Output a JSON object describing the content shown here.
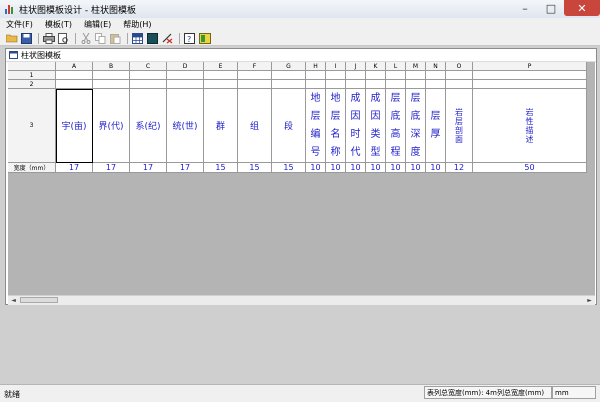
{
  "window": {
    "title": "柱状图模板设计 - 柱状图模板"
  },
  "menu": [
    "文件(F)",
    "模板(T)",
    "编辑(E)",
    "帮助(H)"
  ],
  "toolbar": [
    "open-icon",
    "save-icon",
    "print-icon",
    "print-preview-icon",
    "cut-icon",
    "copy-icon",
    "paste-icon",
    "grid-icon",
    "column-icon",
    "delete-column-icon",
    "help-icon",
    "about-icon"
  ],
  "child": {
    "title": "柱状图模板"
  },
  "grid": {
    "row_headers": [
      "1",
      "2",
      "3",
      "宽度（mm）"
    ],
    "columns": [
      {
        "letter": "A",
        "header": "宇(亩)",
        "width": "17"
      },
      {
        "letter": "B",
        "header": "界(代)",
        "width": "17"
      },
      {
        "letter": "C",
        "header": "系(纪)",
        "width": "17"
      },
      {
        "letter": "D",
        "header": "统(世)",
        "width": "17"
      },
      {
        "letter": "E",
        "header": "群",
        "width": "15"
      },
      {
        "letter": "F",
        "header": "组",
        "width": "15"
      },
      {
        "letter": "G",
        "header": "段",
        "width": "15"
      },
      {
        "letter": "H",
        "header": "地层编号",
        "width": "10"
      },
      {
        "letter": "I",
        "header": "地层名称",
        "width": "10"
      },
      {
        "letter": "J",
        "header": "成因时代",
        "width": "10"
      },
      {
        "letter": "K",
        "header": "成因类型",
        "width": "10"
      },
      {
        "letter": "L",
        "header": "层底高程",
        "width": "10"
      },
      {
        "letter": "M",
        "header": "层底深度",
        "width": "10"
      },
      {
        "letter": "N",
        "header": "层厚",
        "width": "10"
      },
      {
        "letter": "O",
        "header": "岩层剖面",
        "width": "12"
      },
      {
        "letter": "P",
        "header": "岩性描述",
        "width": "50"
      }
    ]
  },
  "status": {
    "left": "就绪",
    "panel": "表列总宽度(mm): 4m",
    "panel2": "列总宽度(mm)",
    "panel3": "mm"
  }
}
